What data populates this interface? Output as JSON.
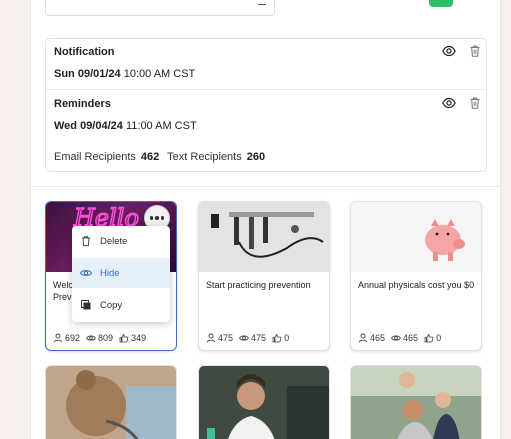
{
  "notification": {
    "title": "Notification",
    "date": "Sun 09/01/24",
    "time": "10:00 AM CST"
  },
  "reminders": {
    "title": "Reminders",
    "date": "Wed 09/04/24",
    "time": "11:00 AM CST"
  },
  "recipients": {
    "email_label": "Email Recipients",
    "email_count": "462",
    "text_label": "Text Recipients",
    "text_count": "260"
  },
  "menu": {
    "delete": "Delete",
    "hide": "Hide",
    "copy": "Copy"
  },
  "cards": [
    {
      "title_line1": "Welc",
      "title_line2": "Preve",
      "users": "692",
      "views": "809",
      "likes": "349",
      "neon_text": "Hello"
    },
    {
      "title": "Start practicing prevention",
      "users": "475",
      "views": "475",
      "likes": "0"
    },
    {
      "title": "Annual physicals cost you $0",
      "users": "465",
      "views": "465",
      "likes": "0"
    }
  ],
  "colors": {
    "accent": "#3b6fd0",
    "hover_bg": "#e6f0fb",
    "success": "#2fbf67"
  }
}
